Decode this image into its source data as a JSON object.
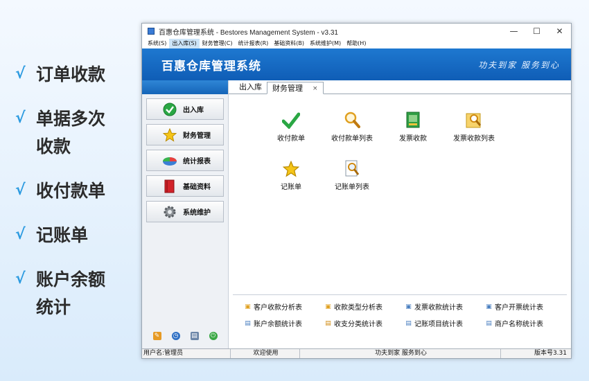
{
  "features": [
    {
      "line1": "订单收款",
      "line2": ""
    },
    {
      "line1": "单据多次",
      "line2": "收款"
    },
    {
      "line1": "收付款单",
      "line2": ""
    },
    {
      "line1": "记账单",
      "line2": ""
    },
    {
      "line1": "账户余额",
      "line2": "统计"
    }
  ],
  "window": {
    "title": "百惠仓库管理系统 - Bestores Management System - v3.31",
    "controls": {
      "minimize": "—",
      "maximize": "☐",
      "close": "✕"
    }
  },
  "menu": [
    "系统(S)",
    "出入库(S)",
    "财务管理(C)",
    "统计报表(R)",
    "基础资料(B)",
    "系统维护(M)",
    "帮助(H)"
  ],
  "banner": {
    "title": "百惠仓库管理系统",
    "slogan": "功夫到家  服务到心"
  },
  "sidebar": {
    "buttons": [
      {
        "label": "出入库",
        "icon": "check-circle-icon"
      },
      {
        "label": "财务管理",
        "icon": "star-icon"
      },
      {
        "label": "统计报表",
        "icon": "pie-chart-icon"
      },
      {
        "label": "基础资料",
        "icon": "book-icon"
      },
      {
        "label": "系统维护",
        "icon": "gear-icon"
      }
    ],
    "footer_icons": [
      "search-doc-icon",
      "clock-icon",
      "print-icon",
      "exit-icon"
    ]
  },
  "tabs": [
    {
      "label": "出入库",
      "active": false
    },
    {
      "label": "财务管理",
      "active": true,
      "close": "×"
    }
  ],
  "grid": [
    {
      "label": "收付款单",
      "icon": "checkmark-icon"
    },
    {
      "label": "收付款单列表",
      "icon": "magnifier-icon"
    },
    {
      "label": "发票收款",
      "icon": "invoice-icon"
    },
    {
      "label": "发票收款列表",
      "icon": "invoice-search-icon"
    },
    {
      "label": "记账单",
      "icon": "star-icon"
    },
    {
      "label": "记账单列表",
      "icon": "document-search-icon"
    }
  ],
  "reports": {
    "row1": [
      "客户收款分析表",
      "收款类型分析表",
      "发票收款统计表",
      "客户开票统计表"
    ],
    "row2": [
      "账户余额统计表",
      "收支分类统计表",
      "记账项目统计表",
      "商户名称统计表"
    ]
  },
  "status": {
    "user": "用户名:管理员",
    "welcome": "欢迎使用",
    "slogan": "功夫到家 服务到心",
    "version": "版本号3.31"
  }
}
